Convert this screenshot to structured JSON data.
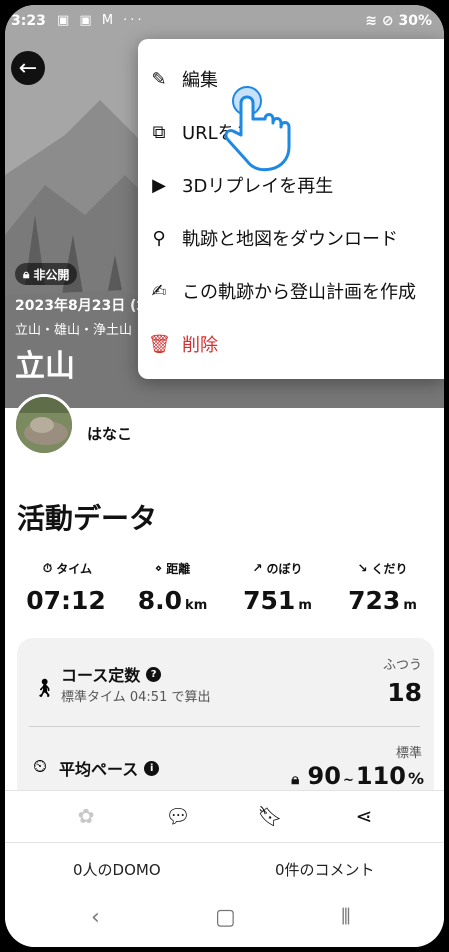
{
  "status_bar": {
    "time": "3:23",
    "left_icons": "▣ ▣ M ···",
    "battery": "30%",
    "icons": [
      "gallery-icon",
      "calendar-icon",
      "gmail-icon",
      "more-icon",
      "wifi-icon",
      "dnd-icon",
      "battery-icon"
    ]
  },
  "hero": {
    "badge": "非公開",
    "date": "2023年8月23日 (水",
    "places": "立山・雄山・浄土山",
    "title": "立山"
  },
  "user": {
    "name": "はなこ"
  },
  "activity": {
    "title": "活動データ",
    "stats": [
      {
        "label": "タイム",
        "value": "07:12",
        "unit": ""
      },
      {
        "label": "距離",
        "value": "8.0",
        "unit": "km"
      },
      {
        "label": "のぼり",
        "value": "751",
        "unit": "m"
      },
      {
        "label": "くだり",
        "value": "723",
        "unit": "m"
      }
    ]
  },
  "course_card": {
    "title": "コース定数",
    "subtitle": "標準タイム 04:51 で算出",
    "level": "ふつう",
    "value": "18"
  },
  "pace_card": {
    "title": "平均ペース",
    "level": "標準",
    "value_low": "90",
    "tilde": "~",
    "value_high": "110",
    "unit": "%"
  },
  "counts": {
    "domo": "0人のDOMO",
    "comments": "0件のコメント"
  },
  "menu": {
    "items": [
      {
        "label": "編集",
        "icon": "pencil-icon"
      },
      {
        "label": "URLをコピー",
        "icon": "copy-icon"
      },
      {
        "label": "3Dリプレイを再生",
        "icon": "play-icon"
      },
      {
        "label": "軌跡と地図をダウンロード",
        "icon": "route-icon"
      },
      {
        "label": "この軌跡から登山計画を作成",
        "icon": "plan-edit-icon"
      },
      {
        "label": "削除",
        "icon": "trash-icon"
      }
    ]
  },
  "colors": {
    "danger": "#d32f2f",
    "hand_outline": "#1e88e5",
    "card_bg": "#f2f2f2"
  }
}
